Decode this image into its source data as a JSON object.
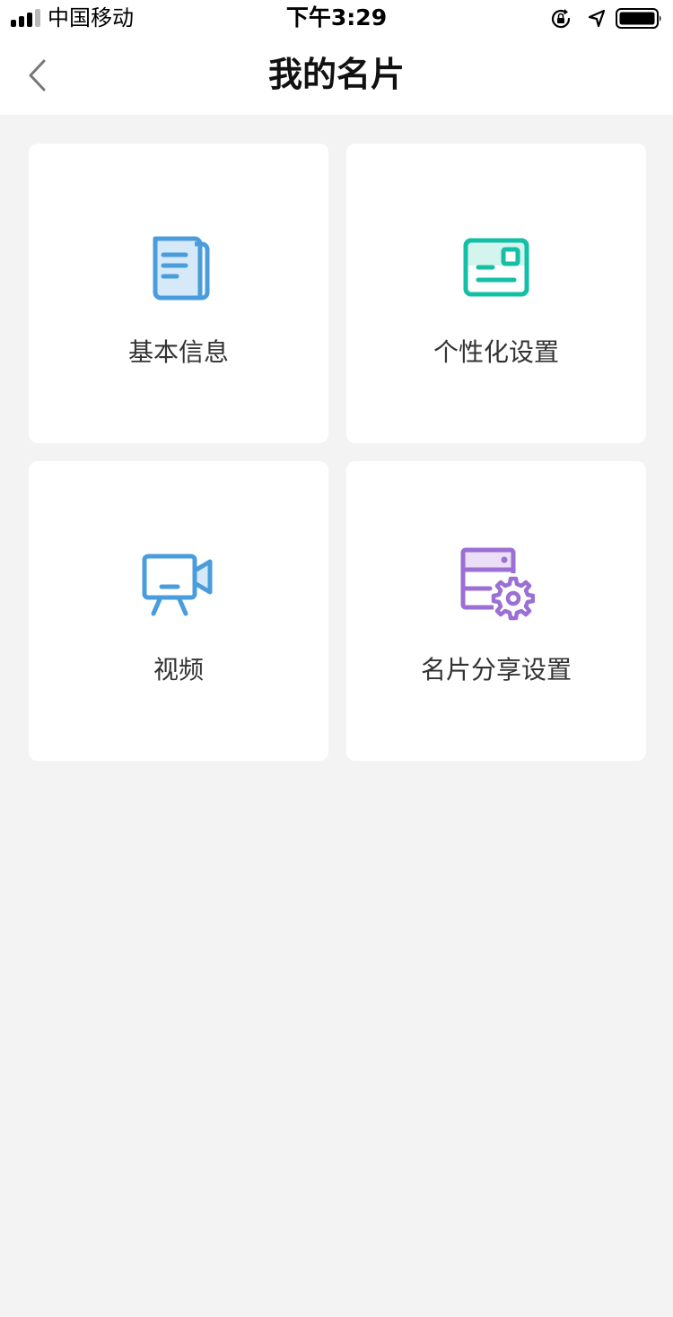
{
  "status_bar": {
    "carrier": "中国移动",
    "time": "下午3:29"
  },
  "nav": {
    "title": "我的名片"
  },
  "cards": [
    {
      "label": "基本信息",
      "icon": "document-icon",
      "color": "#4a9ddc"
    },
    {
      "label": "个性化设置",
      "icon": "id-card-icon",
      "color": "#15bfa5"
    },
    {
      "label": "视频",
      "icon": "video-camera-icon",
      "color": "#4a9ddc"
    },
    {
      "label": "名片分享设置",
      "icon": "server-settings-icon",
      "color": "#9b6fd3"
    }
  ],
  "colors": {
    "background": "#f3f3f3",
    "card": "#ffffff",
    "label_text": "#333333"
  }
}
